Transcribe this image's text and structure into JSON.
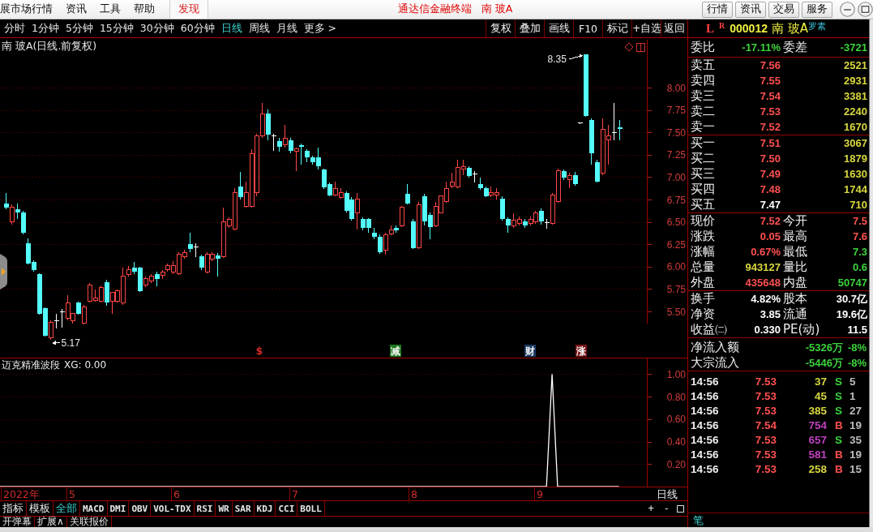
{
  "title_bar": {
    "menus": [
      {
        "label": "展市场行情",
        "highlighted": false
      },
      {
        "label": "资讯",
        "highlighted": false
      },
      {
        "label": "工具",
        "highlighted": false
      },
      {
        "label": "帮助",
        "highlighted": false
      },
      {
        "label": "发现",
        "highlighted": true
      }
    ],
    "app_title": "通达信金融终端",
    "stock_title": "南 玻A",
    "buttons": [
      "行情",
      "资讯",
      "交易",
      "服务"
    ]
  },
  "period_tabs": [
    {
      "label": "分时",
      "selected": false
    },
    {
      "label": "1分钟",
      "selected": false
    },
    {
      "label": "5分钟",
      "selected": false
    },
    {
      "label": "15分钟",
      "selected": false
    },
    {
      "label": "30分钟",
      "selected": false
    },
    {
      "label": "60分钟",
      "selected": false
    },
    {
      "label": "日线",
      "selected": true
    },
    {
      "label": "周线",
      "selected": false
    },
    {
      "label": "月线",
      "selected": false
    },
    {
      "label": "更多 >",
      "selected": false
    }
  ],
  "chart_buttons": [
    "复权",
    "叠加",
    "画线",
    "F10",
    "标记",
    "+自选",
    "返回"
  ],
  "main_chart": {
    "title": "南 玻A(日线.前复权)",
    "price_axis": [
      "8.00",
      "7.75",
      "7.50",
      "7.25",
      "7.00",
      "6.75",
      "6.50",
      "6.25",
      "6.00",
      "5.75",
      "5.50"
    ],
    "high_label": "8.35",
    "low_label": "5.17",
    "event_marks": [
      {
        "label": "$",
        "kind": "symbol",
        "color": "#d82828"
      },
      {
        "label": "减",
        "kind": "badge",
        "color": "#1e781e"
      },
      {
        "label": "财",
        "kind": "badge",
        "color": "#1c3a62"
      },
      {
        "label": "涨",
        "kind": "badge",
        "color": "#781414"
      }
    ]
  },
  "indicator": {
    "name": "迈克精准波段",
    "reading": "XG: 0.00",
    "chart_data": {
      "type": "line",
      "grid": true,
      "ylim": [
        0,
        1.14
      ],
      "yticks": [
        {
          "value": 1,
          "label": "1.00"
        },
        {
          "value": 0.8,
          "label": "0.80"
        },
        {
          "value": 0.6,
          "label": "0.60"
        },
        {
          "value": 0.4,
          "label": "0.40"
        },
        {
          "value": 0.2,
          "label": "0.20"
        }
      ],
      "series": [
        {
          "color": "#ffffff",
          "values": [
            0,
            0,
            0,
            0,
            0,
            0,
            0,
            0,
            0,
            0,
            0,
            0,
            0,
            0,
            0,
            0,
            0,
            0,
            0,
            0,
            0,
            0,
            0,
            0,
            0,
            0,
            0,
            0,
            0,
            0,
            0,
            0,
            0,
            0,
            0,
            0,
            0,
            0,
            0,
            0,
            0,
            0,
            0,
            0,
            0,
            0,
            0,
            0,
            0,
            0,
            0,
            0,
            0,
            0,
            0,
            0,
            0,
            0,
            0,
            0,
            0,
            0,
            0,
            0,
            0,
            0,
            0,
            0,
            0,
            0,
            0,
            0,
            0,
            0,
            0,
            0,
            0,
            0,
            0,
            0,
            0,
            0,
            0,
            0,
            0,
            0,
            0,
            0,
            0,
            0,
            0,
            0,
            0,
            0,
            0,
            0,
            0,
            0,
            0,
            1,
            0,
            0,
            0,
            0,
            0,
            0,
            0,
            0,
            0,
            0,
            0,
            0,
            null,
            null,
            null,
            null,
            null
          ]
        }
      ]
    }
  },
  "date_axis": [
    "2022年",
    "5",
    "6",
    "7",
    "8",
    "9"
  ],
  "period_label": "日线",
  "indicator_tabs": [
    {
      "label": "指标",
      "selected": false
    },
    {
      "label": "模板",
      "selected": false
    },
    {
      "label": "全部",
      "selected": true
    },
    {
      "label": "MACD",
      "selected": false
    },
    {
      "label": "DMI",
      "selected": false
    },
    {
      "label": "OBV",
      "selected": false
    },
    {
      "label": "VOL-TDX",
      "selected": false
    },
    {
      "label": "RSI",
      "selected": false
    },
    {
      "label": "WR",
      "selected": false
    },
    {
      "label": "SAR",
      "selected": false
    },
    {
      "label": "KDJ",
      "selected": false
    },
    {
      "label": "CCI",
      "selected": false
    },
    {
      "label": "BOLL",
      "selected": false
    }
  ],
  "chart_controls": [
    "+",
    "-"
  ],
  "extra_tabs": [
    "开弹幕",
    "扩展∧",
    "关联报价"
  ],
  "quote_panel": {
    "header": {
      "market_flag": "L",
      "rights_flag": "R",
      "code": "000012",
      "name": "南 玻A",
      "tag": "罗素"
    },
    "ratio": [
      {
        "label": "委比",
        "value": "-17.11%",
        "color": "#3cd23c"
      },
      {
        "label": "委差",
        "value": "-3721",
        "color": "#3cd23c"
      }
    ],
    "asks": [
      {
        "label": "卖五",
        "price": "7.56",
        "color": "#ff5050",
        "volume": "2521"
      },
      {
        "label": "卖四",
        "price": "7.55",
        "color": "#ff5050",
        "volume": "2931"
      },
      {
        "label": "卖三",
        "price": "7.54",
        "color": "#ff5050",
        "volume": "3381"
      },
      {
        "label": "卖二",
        "price": "7.53",
        "color": "#ff5050",
        "volume": "2240"
      },
      {
        "label": "卖一",
        "price": "7.52",
        "color": "#ff5050",
        "volume": "1670"
      }
    ],
    "bids": [
      {
        "label": "买一",
        "price": "7.51",
        "color": "#ff5050",
        "volume": "3067"
      },
      {
        "label": "买二",
        "price": "7.50",
        "color": "#ff5050",
        "volume": "1879"
      },
      {
        "label": "买三",
        "price": "7.49",
        "color": "#ff5050",
        "volume": "1630"
      },
      {
        "label": "买四",
        "price": "7.48",
        "color": "#ff5050",
        "volume": "1744"
      },
      {
        "label": "买五",
        "price": "7.47",
        "color": "#ffffff",
        "volume": "710"
      }
    ],
    "stats": [
      [
        {
          "label": "现价",
          "value": "7.52",
          "color": "#ff5050"
        },
        {
          "label": "今开",
          "value": "7.5",
          "color": "#ff5050"
        }
      ],
      [
        {
          "label": "涨跌",
          "value": "0.05",
          "color": "#ff5050"
        },
        {
          "label": "最高",
          "value": "7.6",
          "color": "#ff5050"
        }
      ],
      [
        {
          "label": "涨幅",
          "value": "0.67%",
          "color": "#ff5050"
        },
        {
          "label": "最低",
          "value": "7.3",
          "color": "#3cd23c"
        }
      ],
      [
        {
          "label": "总量",
          "value": "943127",
          "color": "#d8d840"
        },
        {
          "label": "量比",
          "value": "0.6",
          "color": "#3cd23c"
        }
      ],
      [
        {
          "label": "外盘",
          "value": "435648",
          "color": "#ff5050"
        },
        {
          "label": "内盘",
          "value": "50747",
          "color": "#3cd23c"
        }
      ]
    ],
    "fundamentals": [
      [
        {
          "label": "换手",
          "value": "4.82%"
        },
        {
          "label": "股本",
          "value": "30.7亿"
        }
      ],
      [
        {
          "label": "净资",
          "value": "3.85"
        },
        {
          "label": "流通",
          "value": "19.6亿"
        }
      ],
      [
        {
          "label": "收益㈡",
          "value": "0.330"
        },
        {
          "label": "PE(动)",
          "value": "11.5"
        }
      ]
    ],
    "flows": [
      {
        "label": "净流入额",
        "value": "-5326万",
        "ratio": "-8%"
      },
      {
        "label": "大宗流入",
        "value": "-5446万",
        "ratio": "-8%"
      }
    ],
    "ticks": [
      {
        "time": "14:56",
        "price": "7.53",
        "volume": "37",
        "color": "#d8d840",
        "side": "S",
        "kind": "sell",
        "count": "5"
      },
      {
        "time": "14:56",
        "price": "7.53",
        "volume": "45",
        "color": "#d8d840",
        "side": "S",
        "kind": "sell",
        "count": "1"
      },
      {
        "time": "14:56",
        "price": "7.53",
        "volume": "385",
        "color": "#d8d840",
        "side": "S",
        "kind": "sell",
        "count": "27"
      },
      {
        "time": "14:56",
        "price": "7.54",
        "volume": "754",
        "color": "#c040c0",
        "side": "B",
        "kind": "buy",
        "count": "19"
      },
      {
        "time": "14:56",
        "price": "7.53",
        "volume": "657",
        "color": "#c040c0",
        "side": "S",
        "kind": "sell",
        "count": "35"
      },
      {
        "time": "14:56",
        "price": "7.53",
        "volume": "581",
        "color": "#c040c0",
        "side": "B",
        "kind": "buy",
        "count": "19"
      },
      {
        "time": "14:56",
        "price": "7.53",
        "volume": "258",
        "color": "#d8d840",
        "side": "B",
        "kind": "buy",
        "count": "15"
      }
    ],
    "tab": "笔"
  }
}
